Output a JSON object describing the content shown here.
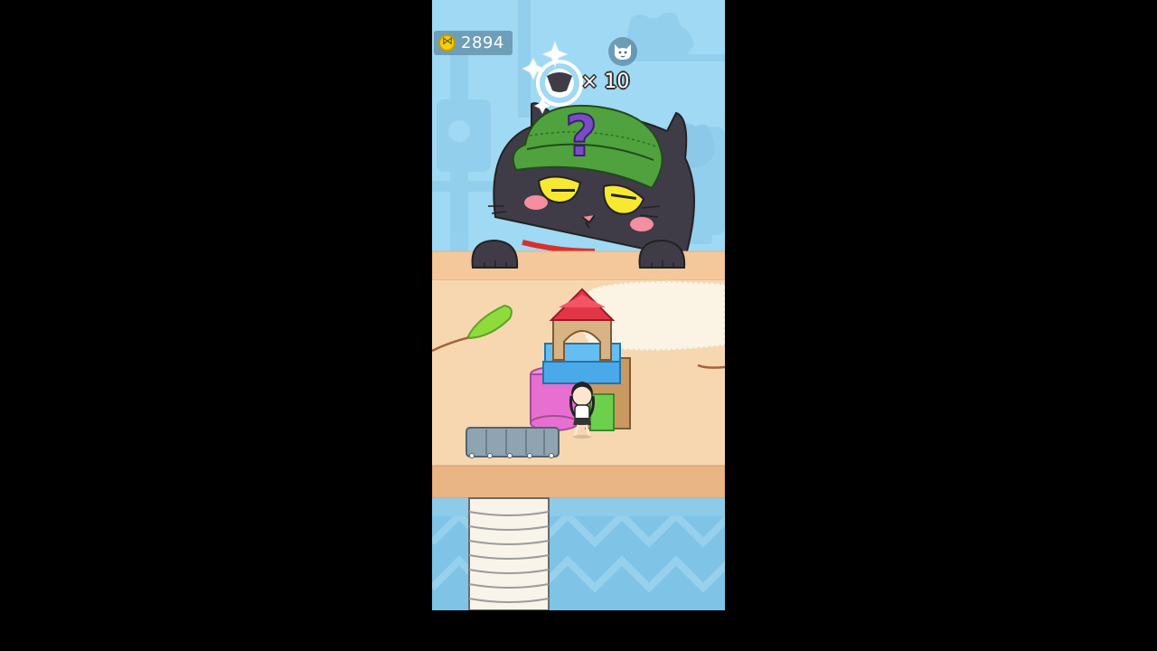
{
  "hud": {
    "coins": "2894",
    "multiplier": "× 10",
    "coin_icon": "coin-icon",
    "cat_icon": "cat-face-icon"
  },
  "scene": {
    "hint_mark": "?",
    "colors": {
      "sky": "#9fd9f3",
      "counter": "#f7d7b0",
      "floor": "#7fc4e6",
      "cat_body": "#3f3c48",
      "hat": "#4fa23e",
      "eyes": "#f7e832",
      "question_mark": "#7a4dc5"
    }
  }
}
